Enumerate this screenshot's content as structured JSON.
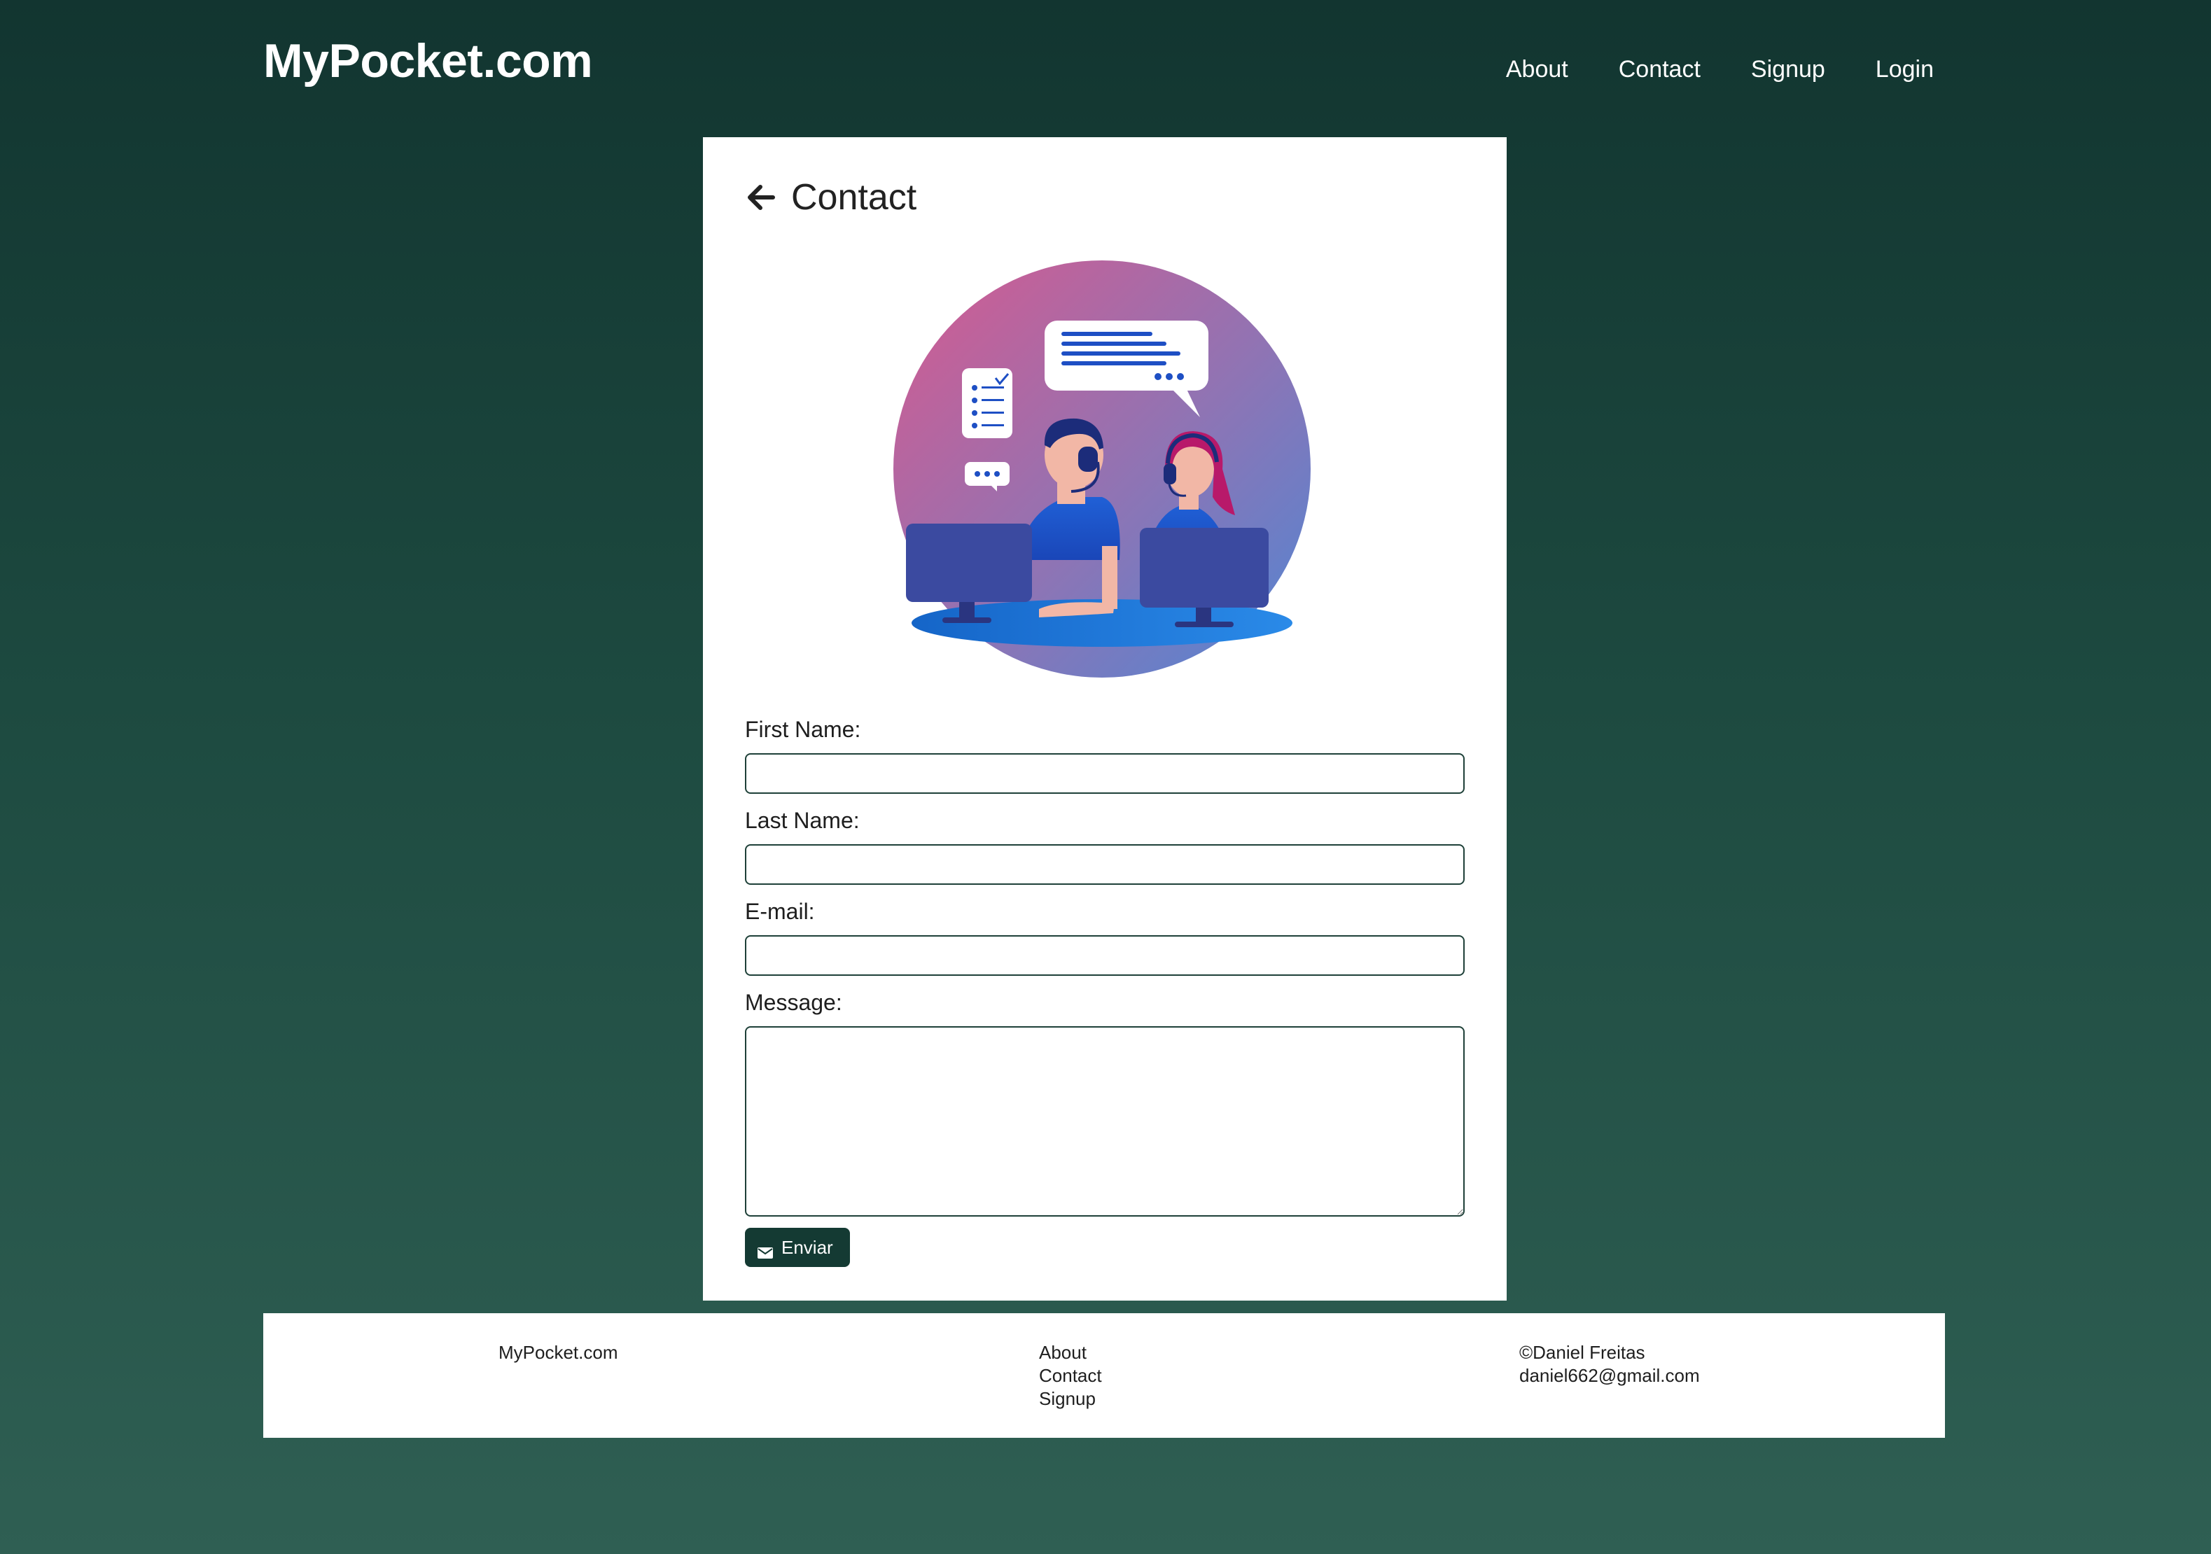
{
  "header": {
    "brand": "MyPocket.com",
    "nav": [
      {
        "label": "About"
      },
      {
        "label": "Contact"
      },
      {
        "label": "Signup"
      },
      {
        "label": "Login"
      }
    ]
  },
  "card": {
    "title": "Contact",
    "back_icon": "arrow-left-icon",
    "illustration": "customer-support-illustration"
  },
  "form": {
    "first_name_label": "First Name:",
    "first_name_value": "",
    "last_name_label": "Last Name:",
    "last_name_value": "",
    "email_label": "E-mail:",
    "email_value": "",
    "message_label": "Message:",
    "message_value": "",
    "submit_label": "Enviar",
    "submit_icon": "envelope-icon"
  },
  "footer": {
    "brand": "MyPocket.com",
    "links": [
      {
        "label": "About"
      },
      {
        "label": "Contact"
      },
      {
        "label": "Signup"
      }
    ],
    "copyright": "©Daniel Freitas",
    "email": "daniel662@gmail.com"
  },
  "colors": {
    "background_top": "#123530",
    "background_bottom": "#2f5f53",
    "button": "#143a33",
    "card": "#ffffff"
  }
}
